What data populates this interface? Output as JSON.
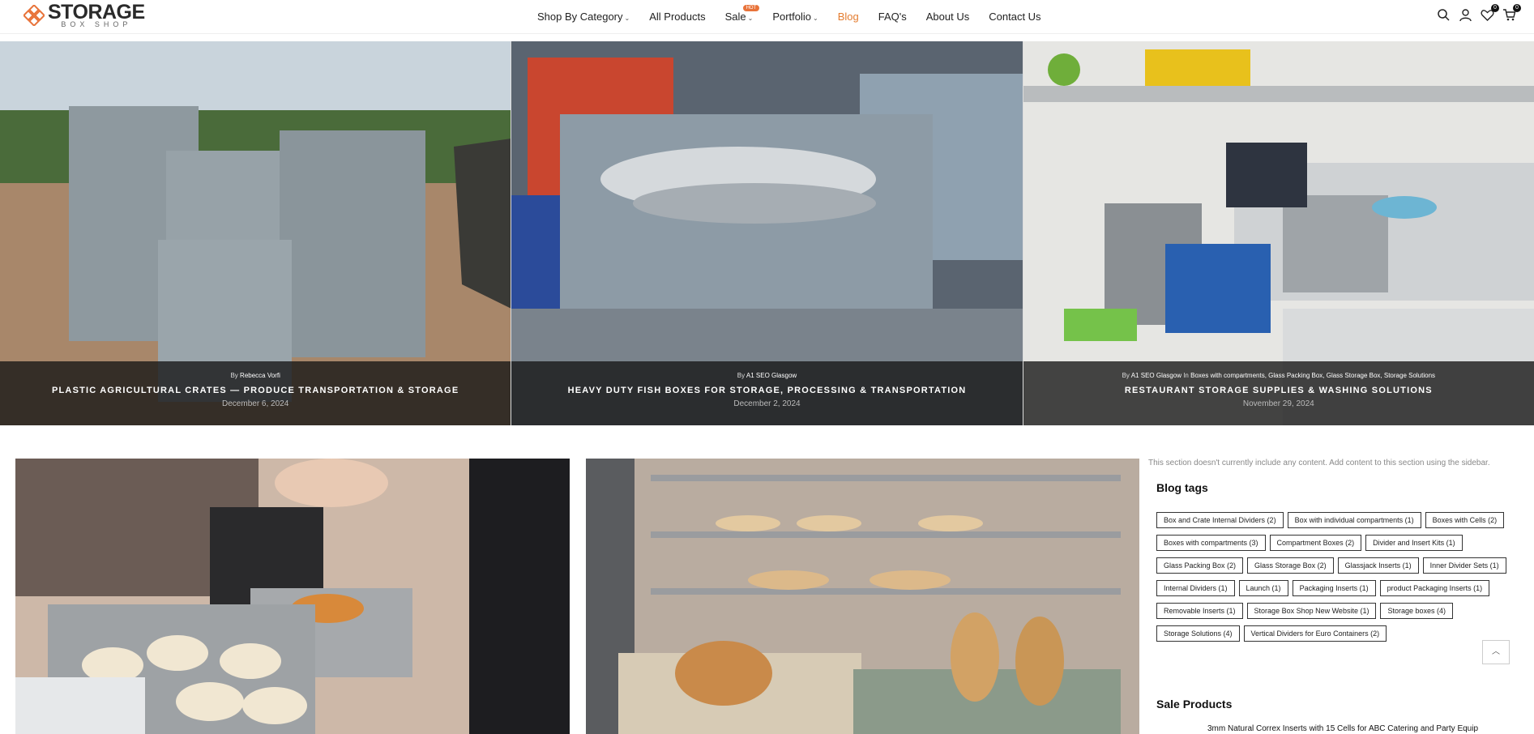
{
  "logo": {
    "main": "STORAGE",
    "sub": "BOX SHOP"
  },
  "nav": {
    "items": [
      {
        "label": "Shop By Category",
        "chevron": true
      },
      {
        "label": "All Products"
      },
      {
        "label": "Sale",
        "chevron": true,
        "badge": "HOT"
      },
      {
        "label": "Portfolio",
        "chevron": true
      },
      {
        "label": "Blog",
        "active": true
      },
      {
        "label": "FAQ's"
      },
      {
        "label": "About Us"
      },
      {
        "label": "Contact Us"
      }
    ]
  },
  "header_icons": {
    "wishlist_count": "0",
    "cart_count": "0"
  },
  "hero_posts": [
    {
      "by": "By",
      "author": "Rebecca Vorfi",
      "categories": "",
      "title": "PLASTIC AGRICULTURAL CRATES — PRODUCE TRANSPORTATION & STORAGE",
      "date": "December 6, 2024"
    },
    {
      "by": "By",
      "author": "A1 SEO Glasgow",
      "categories": "",
      "title": "HEAVY DUTY FISH BOXES FOR STORAGE, PROCESSING & TRANSPORTATION",
      "date": "December 2, 2024"
    },
    {
      "by": "By",
      "author": "A1 SEO Glasgow",
      "in": "In",
      "categories": "Boxes with compartments, Glass Packing Box, Glass Storage Box, Storage Solutions",
      "title": "RESTAURANT STORAGE SUPPLIES & WASHING SOLUTIONS",
      "date": "November 29, 2024"
    }
  ],
  "sidebar": {
    "note": "This section doesn't currently include any content. Add content to this section using the sidebar.",
    "tags_heading": "Blog tags",
    "tags": [
      "Box and Crate Internal Dividers (2)",
      "Box with individual compartments (1)",
      "Boxes with Cells (2)",
      "Boxes with compartments (3)",
      "Compartment Boxes (2)",
      "Divider and Insert Kits (1)",
      "Glass Packing Box (2)",
      "Glass Storage Box (2)",
      "Glassjack Inserts (1)",
      "Inner Divider Sets (1)",
      "Internal Dividers (1)",
      "Launch (1)",
      "Packaging Inserts (1)",
      "product Packaging Inserts (1)",
      "Removable Inserts (1)",
      "Storage Box Shop New Website (1)",
      "Storage boxes (4)",
      "Storage Solutions (4)",
      "Vertical Dividers for Euro Containers (2)"
    ],
    "sale_heading": "Sale Products",
    "sale_item": "3mm Natural Correx Inserts with 15 Cells for ABC Catering and Party Equip"
  }
}
